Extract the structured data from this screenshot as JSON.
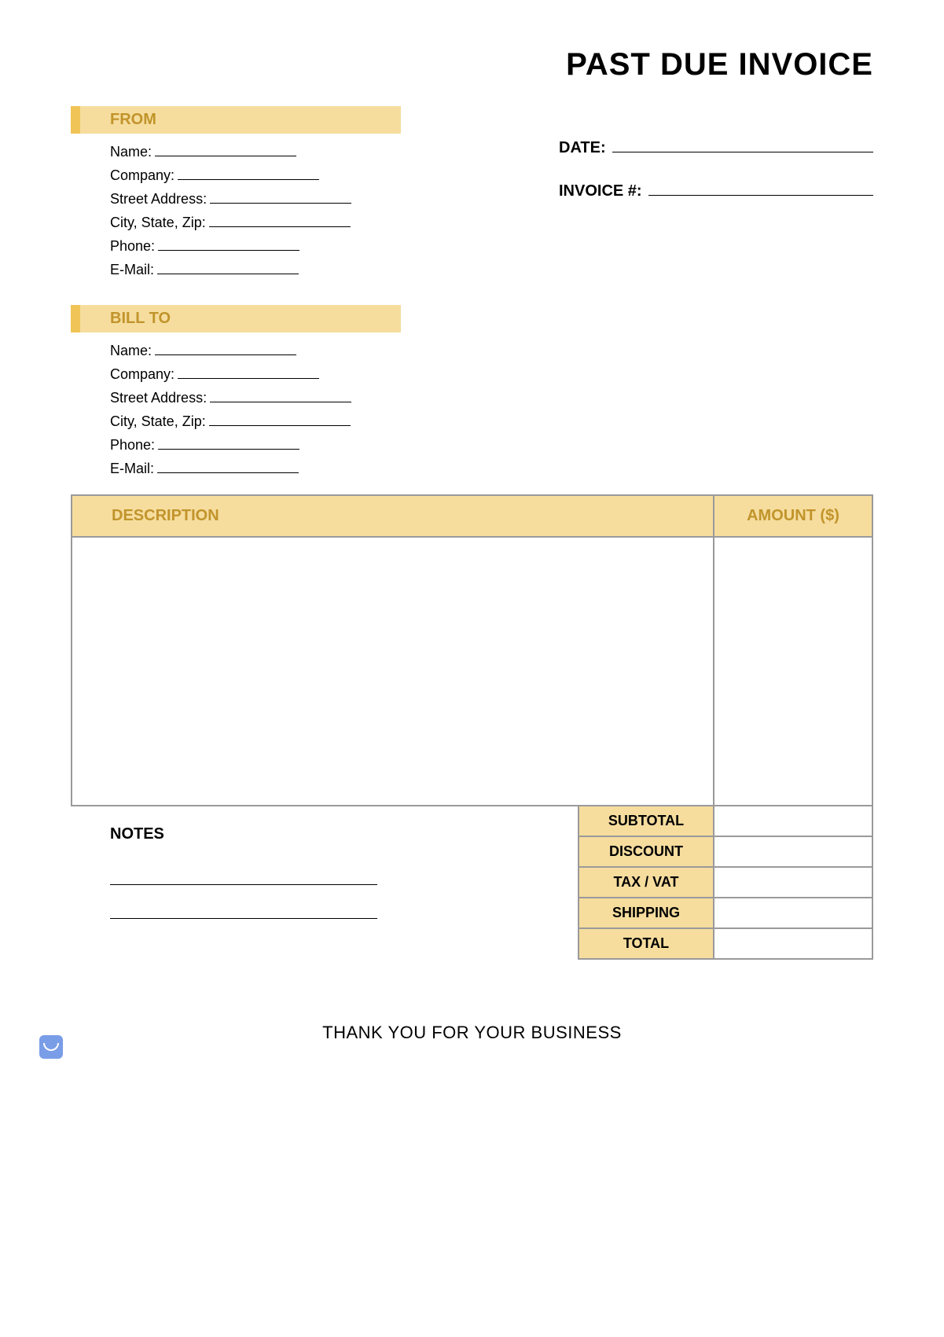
{
  "title": "PAST DUE INVOICE",
  "from": {
    "heading": "FROM",
    "fields": [
      {
        "label": "Name:",
        "uw": 180
      },
      {
        "label": "Company:",
        "uw": 180
      },
      {
        "label": "Street Address:",
        "uw": 180
      },
      {
        "label": "City, State, Zip:",
        "uw": 180
      },
      {
        "label": "Phone:",
        "uw": 180
      },
      {
        "label": "E-Mail:",
        "uw": 180
      }
    ]
  },
  "meta": {
    "date_label": "DATE",
    "invoice_label": "INVOICE #"
  },
  "bill_to": {
    "heading": "BILL TO",
    "fields": [
      {
        "label": "Name:",
        "uw": 180
      },
      {
        "label": "Company:",
        "uw": 180
      },
      {
        "label": "Street Address:",
        "uw": 180
      },
      {
        "label": "City, State, Zip:",
        "uw": 180
      },
      {
        "label": "Phone:",
        "uw": 180
      },
      {
        "label": "E-Mail:",
        "uw": 180
      }
    ]
  },
  "table": {
    "col_description": "DESCRIPTION",
    "col_amount": "AMOUNT ($)"
  },
  "notes": {
    "heading": "NOTES"
  },
  "summary": {
    "rows": [
      {
        "label": "SUBTOTAL"
      },
      {
        "label": "DISCOUNT"
      },
      {
        "label": "TAX / VAT"
      },
      {
        "label": "SHIPPING"
      },
      {
        "label": "TOTAL"
      }
    ]
  },
  "footer": "THANK YOU FOR YOUR BUSINESS"
}
